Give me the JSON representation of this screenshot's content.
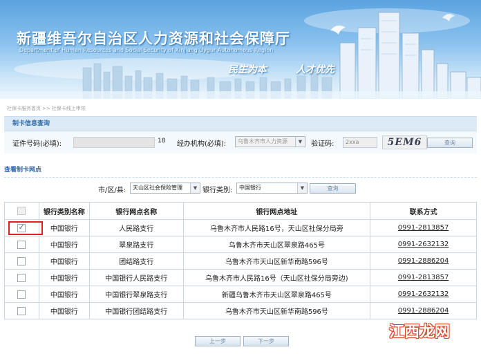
{
  "header": {
    "title_cn": "新疆维吾尔自治区人力资源和社会保障厅",
    "title_en": "Department of Human Resources and Social Security of Xinjiang Uygur Autonomous Region",
    "slogan_1": "民生为本",
    "slogan_2": "人才优先"
  },
  "breadcrumb": {
    "home": "社保卡服务首页",
    "separator": ">>",
    "current": "社保卡线上申领"
  },
  "query_section": {
    "title": "制卡信息查询",
    "id_label": "证件号码(必填):",
    "id_suffix": "18",
    "agency_label": "经办机构(必填):",
    "agency_value": "乌鲁木齐市人力资源",
    "captcha_label": "验证码:",
    "captcha_input_value": "2xxa",
    "captcha_image_text": "5EM6",
    "query_button": "查询"
  },
  "outlet_section": {
    "title": "查看制卡网点",
    "district_label": "市/区/县:",
    "district_value": "天山区社会保险管理",
    "bank_type_label": "银行类别:",
    "bank_type_value": "中国银行",
    "query_button": "查询"
  },
  "table": {
    "headers": [
      "银行类别名称",
      "银行网点名称",
      "银行网点地址",
      "联系方式"
    ],
    "rows": [
      {
        "checked": true,
        "bank": "中国银行",
        "outlet": "人民路支行",
        "address": "乌鲁木齐市人民路16号，天山区社保分局旁",
        "phone": "0991-2813857"
      },
      {
        "checked": false,
        "bank": "中国银行",
        "outlet": "翠泉路支行",
        "address": "乌鲁木齐市天山区翠泉路465号",
        "phone": "0991-2632132"
      },
      {
        "checked": false,
        "bank": "中国银行",
        "outlet": "团结路支行",
        "address": "乌鲁木齐市天山区新华南路596号",
        "phone": "0991-2886204"
      },
      {
        "checked": false,
        "bank": "中国银行",
        "outlet": "中国银行人民路支行",
        "address": "乌鲁木齐市人民路16号（天山区社保分局旁边)",
        "phone": "0991-2813857"
      },
      {
        "checked": false,
        "bank": "中国银行",
        "outlet": "中国银行翠泉路支行",
        "address": "新疆乌鲁木齐市天山区翠泉路465号",
        "phone": "0991-2632132"
      },
      {
        "checked": false,
        "bank": "中国银行",
        "outlet": "中国银行团结路支行",
        "address": "乌鲁木齐市天山区新华南路596号",
        "phone": "0991-2886204"
      }
    ]
  },
  "pager": {
    "prev": "上一步",
    "next": "下一步"
  },
  "watermark": "江西龙网",
  "colors": {
    "accent": "#2f6ba8",
    "highlight_box": "#e0201c"
  }
}
